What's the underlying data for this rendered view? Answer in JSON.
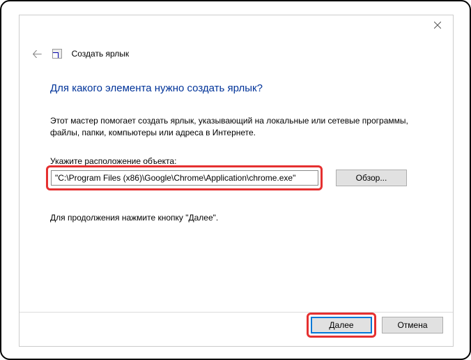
{
  "header": {
    "title": "Создать ярлык"
  },
  "main": {
    "heading": "Для какого элемента нужно создать ярлык?",
    "description": "Этот мастер помогает создать ярлык, указывающий на локальные или сетевые программы, файлы, папки, компьютеры или адреса в Интернете.",
    "field_label": "Укажите расположение объекта:",
    "path_value": "\"C:\\Program Files (x86)\\Google\\Chrome\\Application\\chrome.exe\"",
    "browse_label": "Обзор...",
    "continue_text": "Для продолжения нажмите кнопку \"Далее\"."
  },
  "footer": {
    "next_label": "Далее",
    "cancel_label": "Отмена"
  }
}
